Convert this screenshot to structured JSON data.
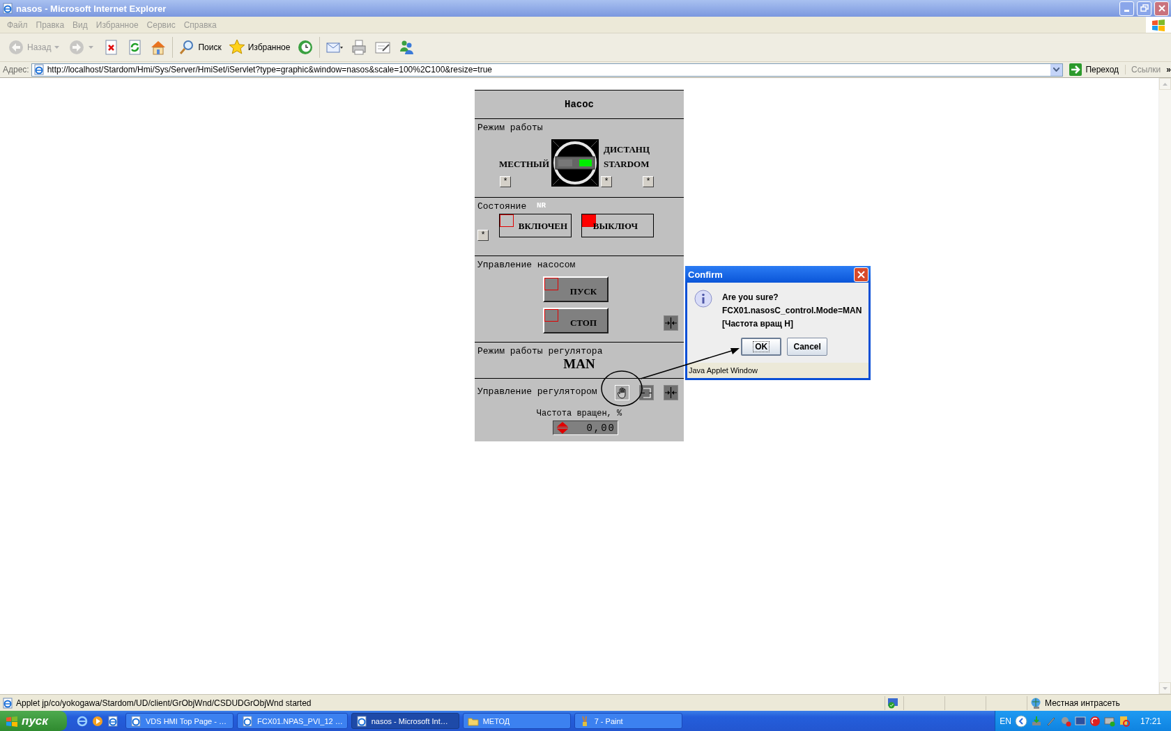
{
  "window": {
    "title": "nasos - Microsoft Internet Explorer"
  },
  "menu": [
    "Файл",
    "Правка",
    "Вид",
    "Избранное",
    "Сервис",
    "Справка"
  ],
  "toolbar": [
    {
      "kind": "back",
      "label": "Назад",
      "disabled": true
    },
    {
      "kind": "forward",
      "disabled": true
    },
    {
      "kind": "stop",
      "disabled": false
    },
    {
      "kind": "refresh",
      "disabled": false
    },
    {
      "kind": "home",
      "disabled": false
    },
    {
      "kind": "search",
      "label": "Поиск",
      "disabled": false
    },
    {
      "kind": "favorites",
      "label": "Избранное",
      "disabled": false
    },
    {
      "kind": "history",
      "disabled": false
    },
    {
      "kind": "mail",
      "disabled": false
    },
    {
      "kind": "print",
      "disabled": false
    },
    {
      "kind": "edit",
      "disabled": false
    },
    {
      "kind": "messenger",
      "disabled": false
    }
  ],
  "address": {
    "label": "Адрес:",
    "url": "http://localhost/Stardom/Hmi/Sys/Server/HmiSet/iServlet?type=graphic&window=nasos&scale=100%2C100&resize=true",
    "go": "Переход",
    "links": "Ссылки",
    "more": "»"
  },
  "panel": {
    "title": "Насос",
    "mode": {
      "label": "Режим работы",
      "options": [
        {
          "label": "МЕСТНЫЙ",
          "selected": false
        },
        {
          "label": "ДИСТАНЦ",
          "selected": true
        }
      ],
      "source": "STARDOM",
      "buttons": [
        "*",
        "*",
        "*"
      ]
    },
    "state": {
      "label": "Состояние",
      "tag": "NR",
      "button": "*",
      "indicators": [
        {
          "label": "ВКЛЮЧЕН",
          "on": false
        },
        {
          "label": "ВЫКЛЮЧ",
          "on": true
        }
      ]
    },
    "pump_control": {
      "label": "Управление насосом",
      "buttons": [
        {
          "label": "ПУСК",
          "on": false
        },
        {
          "label": "СТОП",
          "on": false
        }
      ]
    },
    "regulator_mode": {
      "label": "Режим работы регулятора",
      "value": "MAN"
    },
    "regulator_control": {
      "label": "Управление регулятором",
      "buttons": [
        {
          "kind": "hand",
          "selected": true
        },
        {
          "kind": "frame",
          "selected": false
        },
        {
          "kind": "arrows",
          "selected": false
        }
      ],
      "speed_label": "Частота вращен, %",
      "speed_value": "0,00"
    }
  },
  "dialog": {
    "title": "Confirm",
    "lines": [
      "Are you sure?",
      "FCX01.nasosC_control.Mode=MAN",
      "[Частота вращ Н]"
    ],
    "buttons": [
      {
        "label": "OK",
        "focused": true
      },
      {
        "label": "Cancel",
        "focused": false
      }
    ],
    "footer": "Java Applet Window"
  },
  "status_bar": {
    "text": "Applet jp/co/yokogawa/Stardom/UD/client/GrObjWnd/CSDUDGrObjWnd started",
    "zone": "Местная интрасеть"
  },
  "taskbar": {
    "start": "пуск",
    "tasks": [
      {
        "kind": "browser",
        "label": "VDS HMI Top Page - …",
        "selected": false
      },
      {
        "kind": "browser",
        "label": "FCX01.NPAS_PVI_12 …",
        "selected": false
      },
      {
        "kind": "browser",
        "label": "nasos - Microsoft Int…",
        "selected": true
      },
      {
        "kind": "folder",
        "label": "МЕТОД",
        "selected": false
      },
      {
        "kind": "paint",
        "label": "7 - Paint",
        "selected": false
      }
    ],
    "language": "EN",
    "clock": "17:21"
  }
}
